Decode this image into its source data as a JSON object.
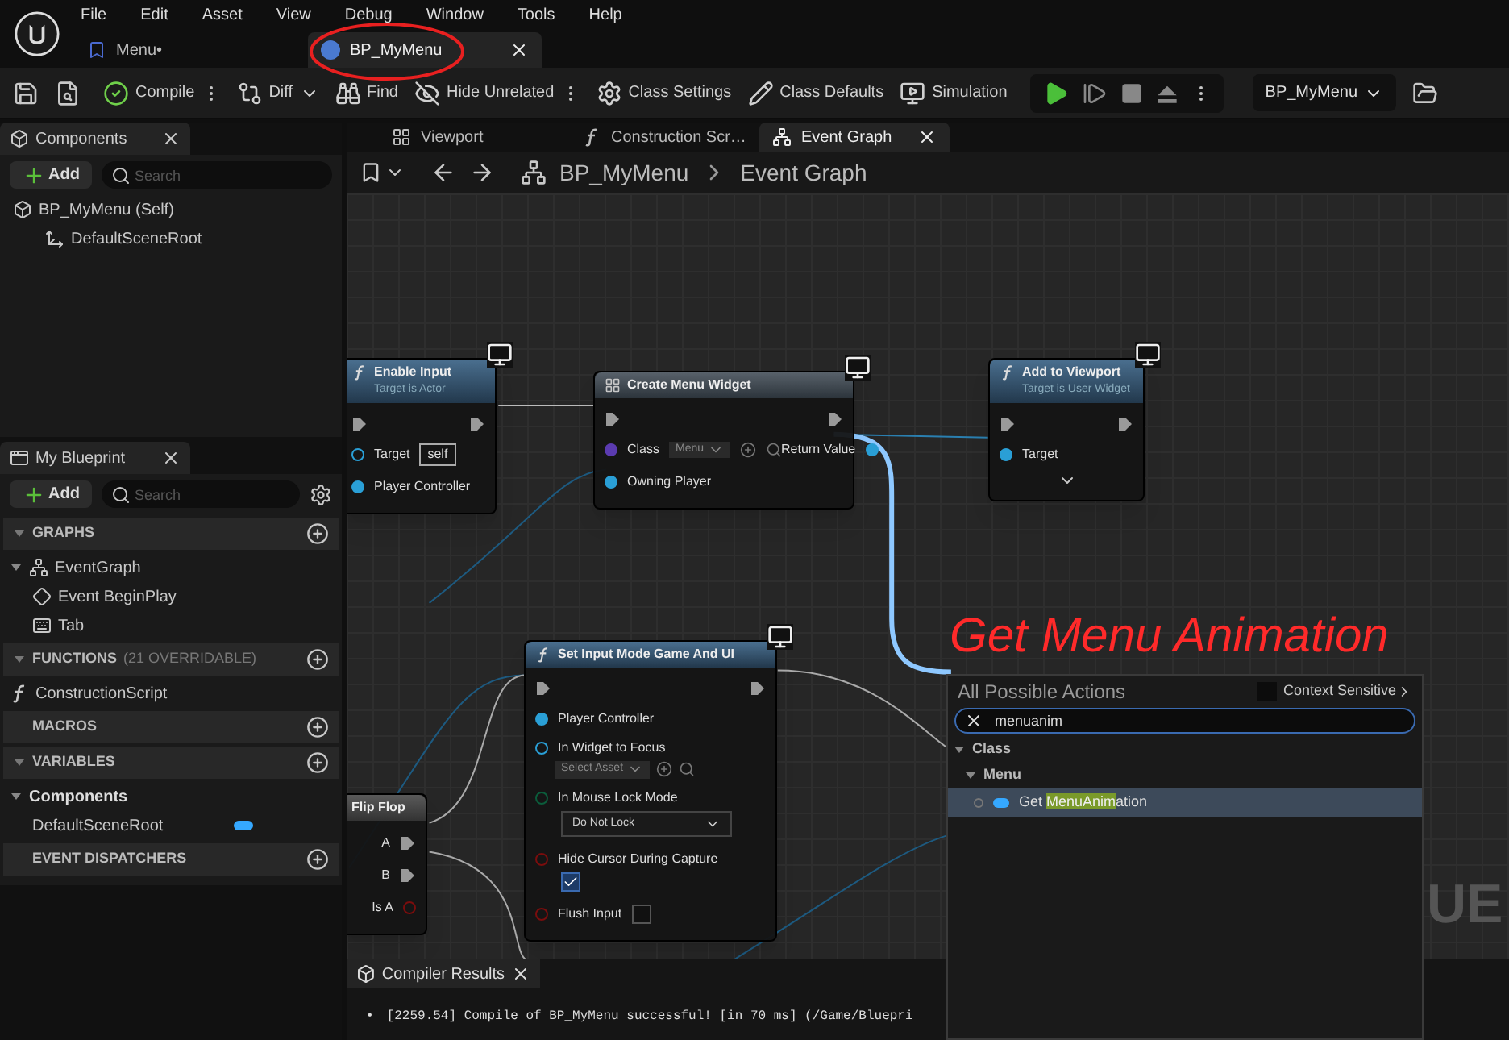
{
  "menu_bar": [
    "File",
    "Edit",
    "Asset",
    "View",
    "Debug",
    "Window",
    "Tools",
    "Help"
  ],
  "document_tabs": [
    {
      "label": "Menu•",
      "selected": false
    },
    {
      "label": "BP_MyMenu",
      "selected": true
    }
  ],
  "toolbar": {
    "buttons": [
      "Compile",
      "Diff",
      "Find",
      "Hide Unrelated",
      "Class Settings",
      "Class Defaults",
      "Simulation"
    ],
    "debug_object": "BP_MyMenu"
  },
  "components_panel": {
    "title": "Components",
    "add_label": "Add",
    "search_placeholder": "Search",
    "tree": [
      {
        "label": "BP_MyMenu (Self)",
        "children": [
          {
            "label": "DefaultSceneRoot"
          }
        ]
      }
    ]
  },
  "my_blueprint": {
    "title": "My Blueprint",
    "add_label": "Add",
    "search_placeholder": "Search",
    "sections": [
      {
        "title": "GRAPHS",
        "expanded": true,
        "items": [
          {
            "kind": "graph",
            "label": "EventGraph",
            "children": [
              {
                "kind": "event",
                "label": "Event BeginPlay"
              },
              {
                "kind": "tab",
                "label": "Tab"
              }
            ]
          }
        ]
      },
      {
        "title": "FUNCTIONS",
        "note": "(21 OVERRIDABLE)",
        "expanded": true,
        "items": [
          {
            "kind": "function",
            "label": "ConstructionScript"
          }
        ]
      },
      {
        "title": "MACROS",
        "expanded": false
      },
      {
        "title": "VARIABLES",
        "expanded": true,
        "items": [
          {
            "kind": "category",
            "label": "Components",
            "children": [
              {
                "kind": "variable",
                "label": "DefaultSceneRoot"
              }
            ]
          }
        ]
      },
      {
        "title": "EVENT DISPATCHERS",
        "expanded": false
      }
    ]
  },
  "editor_tabs": [
    {
      "label": "Viewport",
      "selected": false
    },
    {
      "label": "Construction Scr…",
      "selected": false
    },
    {
      "label": "Event Graph",
      "selected": true
    }
  ],
  "breadcrumb": [
    "BP_MyMenu",
    "Event Graph"
  ],
  "graph": {
    "watermark": "UE",
    "nodes": [
      {
        "kind": "function",
        "title": "Enable Input",
        "subtitle": "Target is Actor",
        "exec": true,
        "inputs": [
          {
            "kind": "object",
            "label": "Target",
            "value": "self"
          },
          {
            "kind": "object",
            "label": "Player Controller"
          }
        ]
      },
      {
        "kind": "widget",
        "title": "Create Menu Widget",
        "exec": true,
        "inputs": [
          {
            "kind": "class",
            "label": "Class",
            "value": "Menu"
          },
          {
            "kind": "object",
            "label": "Owning Player"
          }
        ],
        "outputs": [
          {
            "kind": "object",
            "label": "Return Value"
          }
        ]
      },
      {
        "kind": "function",
        "title": "Add to Viewport",
        "subtitle": "Target is User Widget",
        "exec": true,
        "inputs": [
          {
            "kind": "object",
            "label": "Target"
          }
        ]
      },
      {
        "kind": "function",
        "title": "Set Input Mode Game And UI",
        "exec": true,
        "inputs": [
          {
            "kind": "object",
            "label": "Player Controller"
          },
          {
            "kind": "asset",
            "label": "In Widget to Focus",
            "value": "Select Asset"
          },
          {
            "kind": "enum",
            "label": "In Mouse Lock Mode",
            "value": "Do Not Lock"
          },
          {
            "kind": "bool",
            "label": "Hide Cursor During Capture",
            "checked": true
          },
          {
            "kind": "bool",
            "label": "Flush Input",
            "checked": false
          }
        ]
      },
      {
        "kind": "macro",
        "title": "Flip Flop",
        "exec": false,
        "outputs": [
          {
            "kind": "exec",
            "label": "A"
          },
          {
            "kind": "exec",
            "label": "B"
          },
          {
            "kind": "bool",
            "label": "Is A"
          }
        ]
      }
    ]
  },
  "annotation": {
    "text": "Get Menu Animation"
  },
  "action_menu": {
    "title": "All Possible Actions",
    "context_sensitive": {
      "label": "Context Sensitive",
      "checked": false
    },
    "search_value": "menuanim",
    "tree": [
      {
        "label": "Class",
        "expanded": true,
        "children": [
          {
            "label": "Menu",
            "expanded": true,
            "children": [
              {
                "kind": "action",
                "selected": true,
                "label_parts": [
                  {
                    "text": "Get ",
                    "highlight": false
                  },
                  {
                    "text": "MenuAnim",
                    "highlight": true
                  },
                  {
                    "text": "ation",
                    "highlight": false
                  }
                ]
              }
            ]
          }
        ]
      }
    ]
  },
  "compiler_results": {
    "title": "Compiler Results",
    "messages": [
      {
        "bullet": "•",
        "text": "[2259.54] Compile of BP_MyMenu successful! [in 70 ms] (/Game/Bluepri"
      }
    ]
  }
}
